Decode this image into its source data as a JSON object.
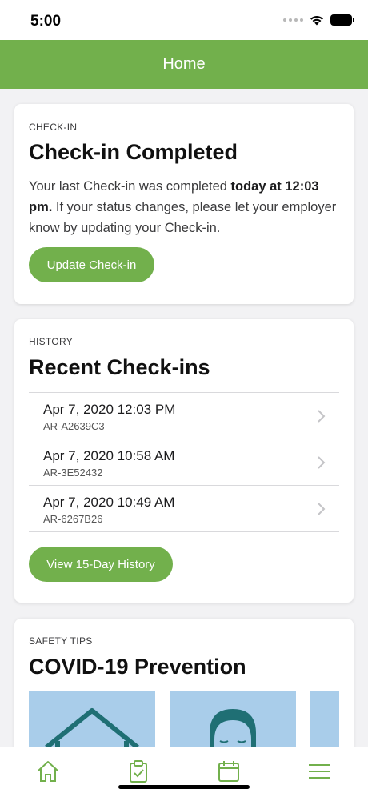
{
  "status_bar": {
    "time": "5:00"
  },
  "nav": {
    "title": "Home"
  },
  "checkin_card": {
    "eyebrow": "CHECK-IN",
    "title": "Check-in Completed",
    "text_before": "Your last Check-in was completed ",
    "text_bold": "today at 12:03 pm.",
    "text_after": " If your status changes, please let your employer know by updating your Check-in.",
    "button_label": "Update Check-in"
  },
  "history_card": {
    "eyebrow": "HISTORY",
    "title": "Recent Check-ins",
    "items": [
      {
        "date": "Apr 7, 2020 12:03 PM",
        "code": "AR-A2639C3"
      },
      {
        "date": "Apr 7, 2020 10:58 AM",
        "code": "AR-3E52432"
      },
      {
        "date": "Apr 7, 2020 10:49 AM",
        "code": "AR-6267B26"
      }
    ],
    "button_label": "View 15-Day History"
  },
  "tips_card": {
    "eyebrow": "SAFETY TIPS",
    "title": "COVID-19 Prevention"
  },
  "tab_bar": {
    "tabs": [
      "home-icon",
      "clipboard-check-icon",
      "calendar-icon",
      "menu-icon"
    ]
  },
  "colors": {
    "brand_green": "#72b04c",
    "tip_image_blue": "#a9cdea",
    "tip_image_teal": "#1f6f74"
  }
}
